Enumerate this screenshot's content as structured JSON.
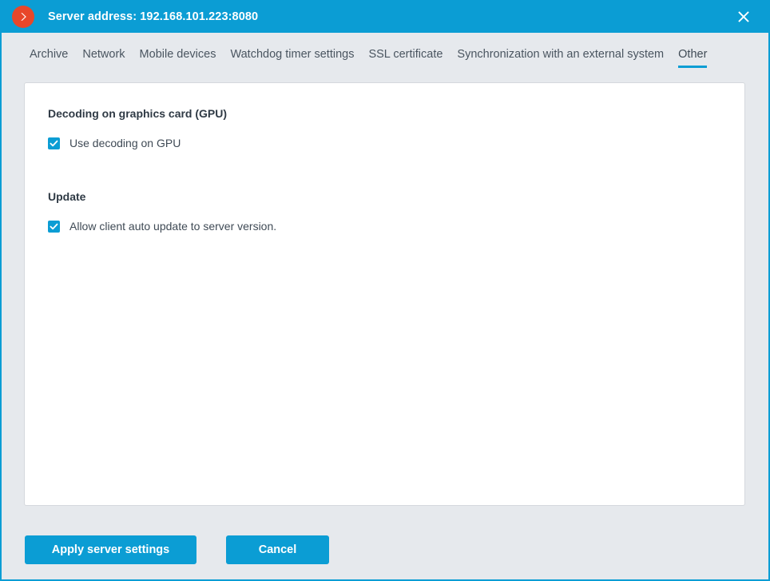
{
  "titlebar": {
    "logo_icon": "chevron-right-circle-icon",
    "title": "Server address: 192.168.101.223:8080",
    "close_icon": "close-icon",
    "background_color": "#0b9dd4",
    "logo_color": "#e8472a"
  },
  "tabs": [
    {
      "label": "Archive",
      "active": false
    },
    {
      "label": "Network",
      "active": false
    },
    {
      "label": "Mobile devices",
      "active": false
    },
    {
      "label": "Watchdog timer settings",
      "active": false
    },
    {
      "label": "SSL certificate",
      "active": false
    },
    {
      "label": "Synchronization with an external system",
      "active": false
    },
    {
      "label": "Other",
      "active": true
    }
  ],
  "content": {
    "sections": [
      {
        "title": "Decoding on graphics card (GPU)",
        "checkbox": {
          "label": "Use decoding on GPU",
          "checked": true
        }
      },
      {
        "title": "Update",
        "checkbox": {
          "label": "Allow client auto update to server version.",
          "checked": true
        }
      }
    ]
  },
  "footer": {
    "apply_label": "Apply server settings",
    "cancel_label": "Cancel",
    "button_color": "#0b9dd4"
  }
}
